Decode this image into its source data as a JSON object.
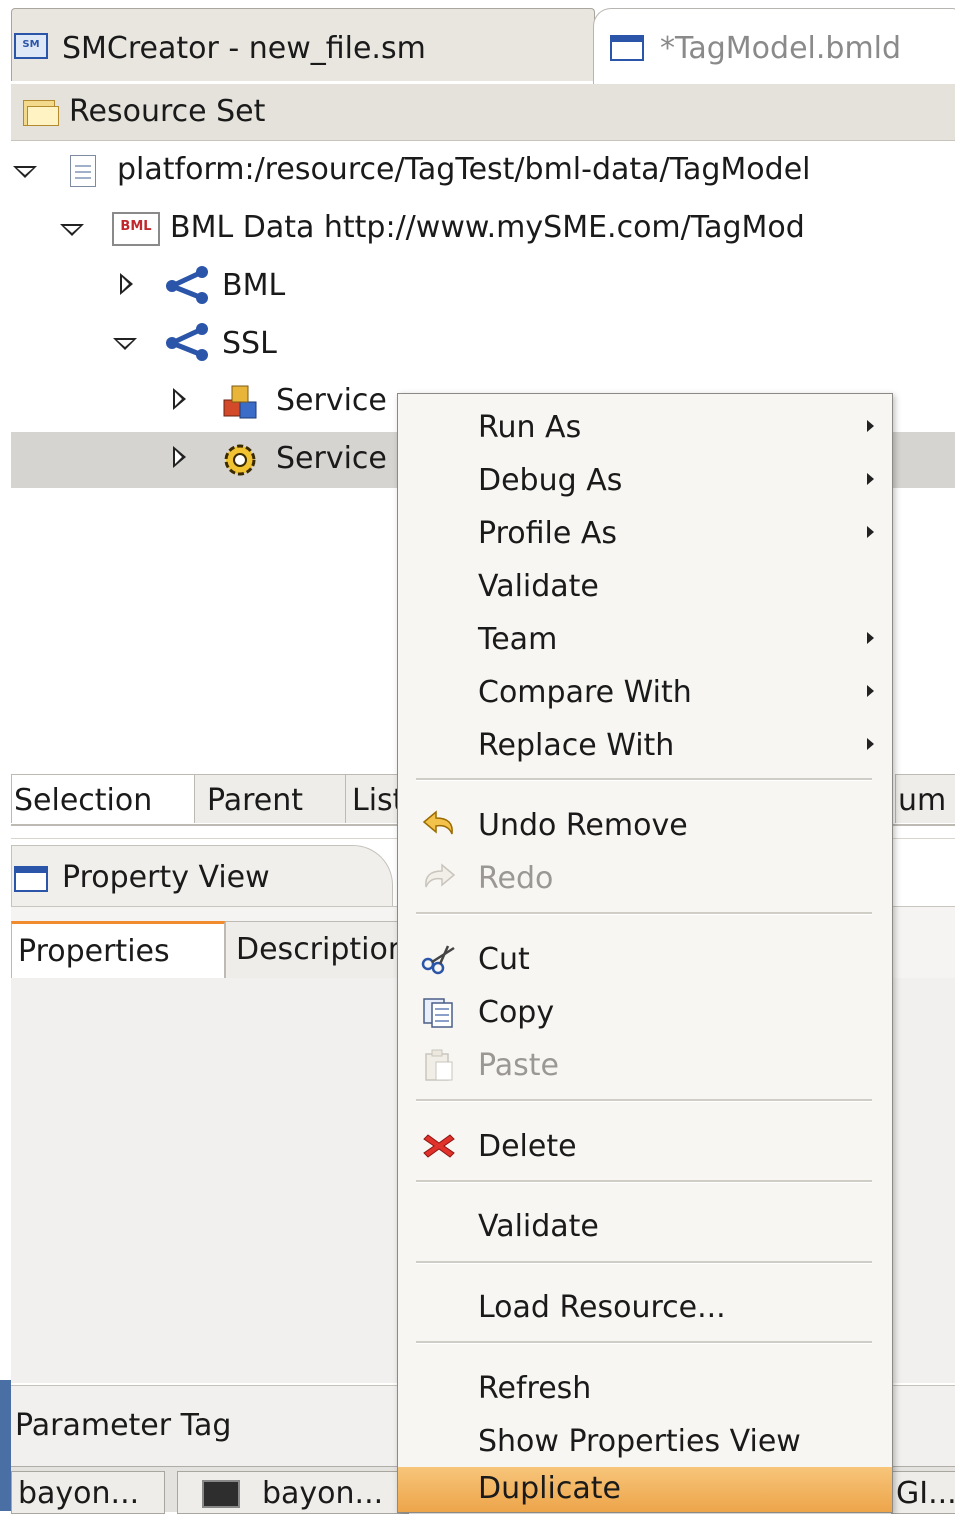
{
  "editor_tabs": [
    {
      "label": "SMCreator - new_file.sm",
      "icon": "sm-file-icon"
    },
    {
      "label": "*TagModel.bmld",
      "icon": "window-icon"
    }
  ],
  "resource_set": {
    "title": "Resource Set",
    "icon": "folder-icon"
  },
  "tree": {
    "root": "platform:/resource/TagTest/bml-data/TagModel",
    "bml_data": "BML Data http://www.mySME.com/TagMod",
    "bml": "BML",
    "ssl": "SSL",
    "service1": "Service Profile MyService",
    "service2": "Service"
  },
  "view_tabs": [
    "Selection",
    "Parent",
    "List",
    "um"
  ],
  "property_view": {
    "title": "Property View"
  },
  "property_tabs": [
    "Properties",
    "Description"
  ],
  "param_label": "Parameter Tag",
  "taskbar": [
    "bayon...",
    "bayon...",
    "GI..."
  ],
  "menu": {
    "items": [
      {
        "label": "Run As",
        "mnemonic": "R",
        "submenu": true
      },
      {
        "label": "Debug As",
        "mnemonic": "D",
        "submenu": true
      },
      {
        "label": "Profile As",
        "mnemonic": "P",
        "submenu": true
      },
      {
        "label": "Validate",
        "submenu": false
      },
      {
        "label": "Team",
        "mnemonic": "e",
        "submenu": true
      },
      {
        "label": "Compare With",
        "mnemonic": "a",
        "submenu": true
      },
      {
        "label": "Replace With",
        "mnemonic": "l",
        "submenu": true
      },
      {
        "label": "Undo Remove",
        "icon": "undo-icon"
      },
      {
        "label": "Redo",
        "icon": "redo-icon",
        "disabled": true
      },
      {
        "label": "Cut",
        "icon": "scissors-icon"
      },
      {
        "label": "Copy",
        "icon": "copy-icon"
      },
      {
        "label": "Paste",
        "icon": "paste-icon",
        "disabled": true
      },
      {
        "label": "Delete",
        "icon": "delete-icon"
      },
      {
        "label": "Validate"
      },
      {
        "label": "Load Resource..."
      },
      {
        "label": "Refresh"
      },
      {
        "label": "Show Properties View"
      },
      {
        "label": "Duplicate",
        "highlighted": true
      }
    ]
  },
  "colors": {
    "highlight": "#f5b35a",
    "accent_tab": "#f08c2d",
    "selection_row": "#d6d4d0"
  }
}
